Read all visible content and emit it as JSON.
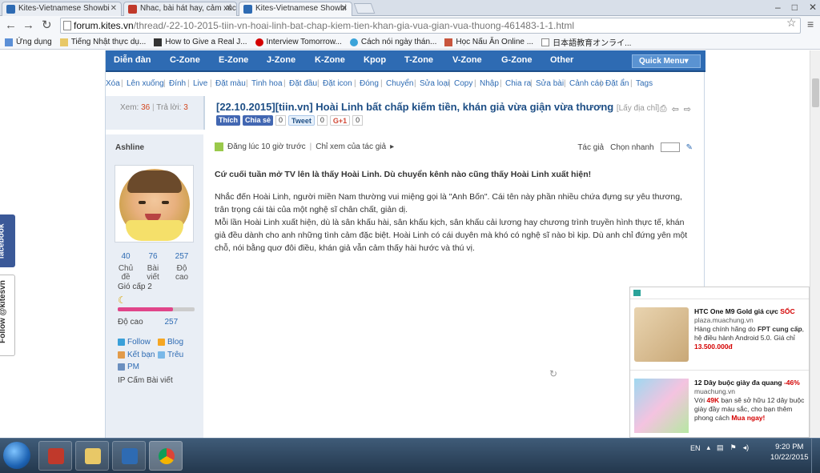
{
  "tabs": [
    {
      "label": "Kites-Vietnamese Showbi",
      "color": "#2e6bb3"
    },
    {
      "label": "Nhac, bài hát hay, cảm xúc",
      "color": "#c0392b"
    },
    {
      "label": "Kites-Vietnamese Showbi",
      "color": "#2e6bb3"
    }
  ],
  "window_controls": [
    "–",
    "□",
    "✕"
  ],
  "url": {
    "host": "forum.kites.vn",
    "path": "/thread/-22-10-2015-tiin-vn-hoai-linh-bat-chap-kiem-tien-khan-gia-vua-gian-vua-thuong-461483-1-1.html"
  },
  "bookmarks": [
    {
      "label": "Ứng dụng",
      "icon": "apps-icon"
    },
    {
      "label": "Tiếng Nhật thực dụ...",
      "icon": "folder-icon"
    },
    {
      "label": "How to Give a Real J...",
      "icon": "h-icon"
    },
    {
      "label": "Interview Tomorrow...",
      "icon": "red-dot-icon"
    },
    {
      "label": "Cách nói ngày thán...",
      "icon": "globe-icon"
    },
    {
      "label": "Học Nấu Ăn Online ...",
      "icon": "hat-icon"
    },
    {
      "label": "日本語教育オンライ...",
      "icon": "doc-icon"
    }
  ],
  "nav": [
    "Diễn đàn",
    "C-Zone",
    "E-Zone",
    "J-Zone",
    "K-Zone",
    "Kpop",
    "T-Zone",
    "V-Zone",
    "G-Zone",
    "Other"
  ],
  "quick_menu": "Quick Menu▾",
  "mod_actions": [
    "Xóa",
    "Lên xuống",
    "Đính",
    "Live",
    "Đặt màu",
    "Tinh hoa",
    "Đặt đầu",
    "Đặt icon",
    "Đóng",
    "Chuyển",
    "Sửa loại",
    "Copy",
    "Nhập",
    "Chia ra",
    "Sửa bài",
    "Cảnh cáo",
    "Đặt ẩn",
    "Tags"
  ],
  "thread_stats": {
    "views_label": "Xem:",
    "views": "36",
    "replies_label": "Trả lời:",
    "replies": "3"
  },
  "thread": {
    "title": "[22.10.2015][tiin.vn] Hoài Linh bất chấp kiếm tiền, khán giả vừa giận vừa thương",
    "source_link": "[Lấy địa chỉ]"
  },
  "share": {
    "like": "Thích",
    "share": "Chia sẻ",
    "like_count": "0",
    "tweet": "Tweet",
    "tweet_count": "0",
    "gplus": "G+1",
    "gplus_count": "0"
  },
  "user": {
    "name": "Ashline",
    "stats": [
      {
        "value": "40",
        "label": "Chủ đề"
      },
      {
        "value": "76",
        "label": "Bài viết"
      },
      {
        "value": "257",
        "label": "Độ cao"
      }
    ],
    "level": "Gió cấp 2",
    "level_progress": 0.72,
    "height_label": "Độ cao",
    "height_value": "257",
    "links": [
      "Follow",
      "Blog",
      "Kết bạn",
      "Trêu",
      "PM"
    ],
    "ip_label": "IP Cấm Bài viết"
  },
  "post": {
    "posted": "Đăng lúc 10  giờ trước",
    "author_only": "Chỉ xem của tác giả",
    "author": "Tác giả",
    "quick_select": "Chọn nhanh",
    "lead": "Cứ cuối tuần mở TV lên là thấy Hoài Linh. Dù chuyển kênh nào cũng thấy Hoài Linh xuất hiện!",
    "paragraphs": [
      "Nhắc đến Hoài Linh, người miền Nam thường vui miệng gọi là \"Anh Bốn\". Cái tên này phần nhiều chứa đựng sự yêu thương, trân trọng cái tài của một nghệ sĩ chân chất, giản dị.",
      "Mỗi lần Hoài Linh xuất hiện, dù là sân khấu hài, sân khấu kịch, sân khấu cải lương hay chương trình truyền hình thực tế, khán giả đều dành cho anh những tình cảm đặc biệt. Hoài Linh có cái duyên mà khó có nghệ sĩ nào bì kịp. Dù anh chỉ đứng yên một chỗ, nói bằng quơ đôi điều, khán giả vẫn cảm thấy hài hước và thú vị."
    ]
  },
  "side_tabs": {
    "facebook": "facebook",
    "twitter": "Follow @kitesvn"
  },
  "ads": [
    {
      "title": "HTC One M9 Gold giá cực ",
      "title_hl": "SỐC",
      "site": "plaza.muachung.vn",
      "desc_a": "Hàng chính hãng do ",
      "desc_b": "FPT cung cấp",
      "desc_c": ", hệ điều hành Android 5.0. Giá chỉ",
      "price": "13.500.000đ"
    },
    {
      "title": "12 Dây buộc giày đa quang ",
      "title_hl": "-46%",
      "site": "muachung.vn",
      "desc_a": "Với ",
      "desc_b": "49K",
      "desc_c": " bạn sẽ sở hữu 12 dây buộc giày đầy màu sắc, cho bạn thêm phong cách ",
      "price": "Mua ngay!"
    }
  ],
  "taskbar": {
    "lang": "EN",
    "time": "9:20 PM",
    "date": "10/22/2015"
  }
}
